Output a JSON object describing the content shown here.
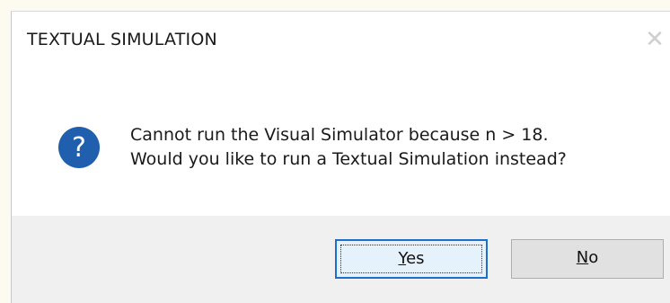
{
  "dialog": {
    "title": "TEXTUAL SIMULATION",
    "close_glyph": "✕",
    "icon": "question-icon",
    "message_line1": "Cannot run the Visual Simulator because n > 18.",
    "message_line2": "Would you like to run a Textual Simulation instead?"
  },
  "buttons": {
    "yes": {
      "mnemonic": "Y",
      "rest": "es"
    },
    "no": {
      "mnemonic": "N",
      "rest": "o"
    }
  },
  "colors": {
    "icon_blue": "#1f5fae",
    "focus_border": "#1e6fcc",
    "footer_bg": "#f0f0f0"
  }
}
